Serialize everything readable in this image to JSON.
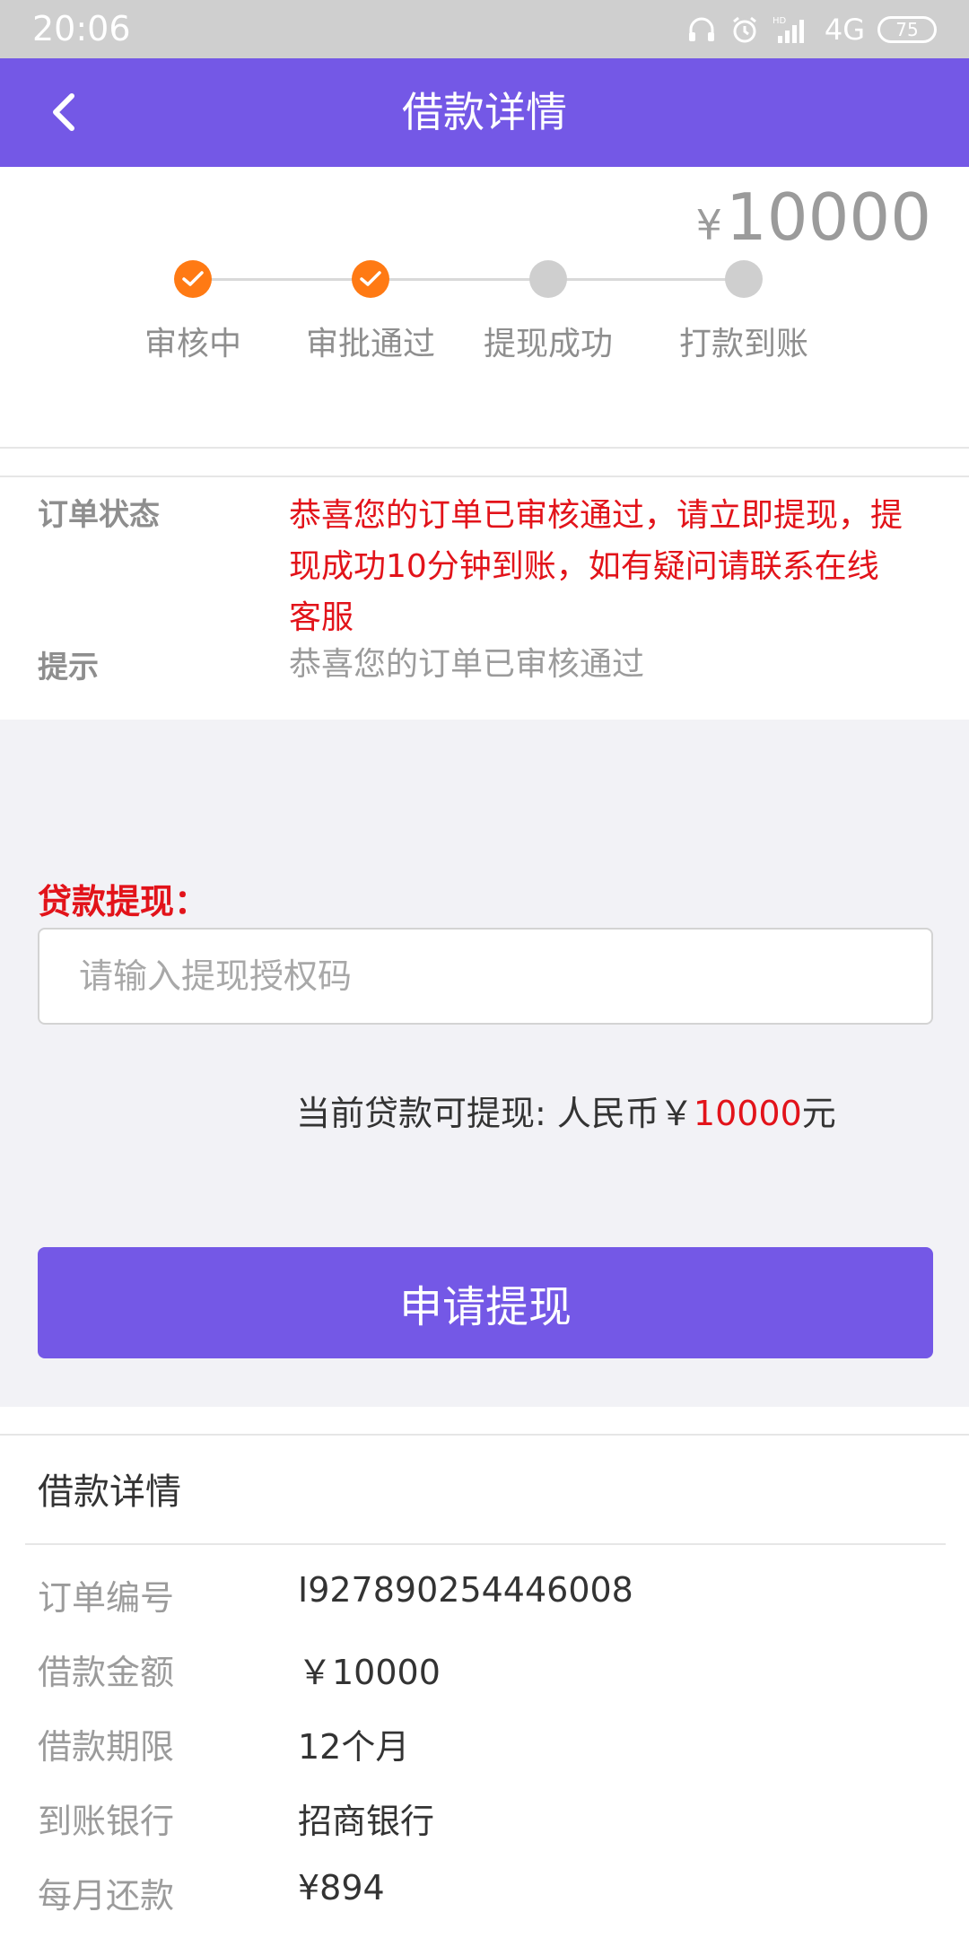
{
  "status_bar": {
    "time": "20:06",
    "network": "4G",
    "hd": "HD",
    "battery": "75"
  },
  "header": {
    "title": "借款详情"
  },
  "progress": {
    "currency": "¥",
    "amount": "10000",
    "steps": [
      {
        "label": "审核中",
        "done": true
      },
      {
        "label": "审批通过",
        "done": true
      },
      {
        "label": "提现成功",
        "done": false
      },
      {
        "label": "打款到账",
        "done": false
      }
    ]
  },
  "order_info": {
    "status_label": "订单状态",
    "status_line1": "恭喜您的订单已审核通过，请立即提现，提",
    "status_line2": "现成功10分钟到账，如有疑问请联系在线",
    "status_line3": "客服",
    "hint_label": "提示",
    "hint_value": "恭喜您的订单已审核通过"
  },
  "withdraw": {
    "title": "贷款提现：",
    "input_placeholder": "请输入提现授权码",
    "available_prefix": "当前贷款可提现: 人民币￥",
    "available_amount": "10000",
    "available_suffix": "元",
    "button_label": "申请提现"
  },
  "details": {
    "title": "借款详情",
    "rows": [
      {
        "label": "订单编号",
        "value": "I927890254446008"
      },
      {
        "label": "借款金额",
        "value": "￥10000"
      },
      {
        "label": "借款期限",
        "value": "12个月"
      },
      {
        "label": "到账银行",
        "value": "招商银行"
      },
      {
        "label": "每月还款",
        "value": "¥894"
      }
    ]
  },
  "colors": {
    "brand": "#7458e6",
    "step_done": "#ff7a14",
    "alert_red": "#e2131a"
  }
}
